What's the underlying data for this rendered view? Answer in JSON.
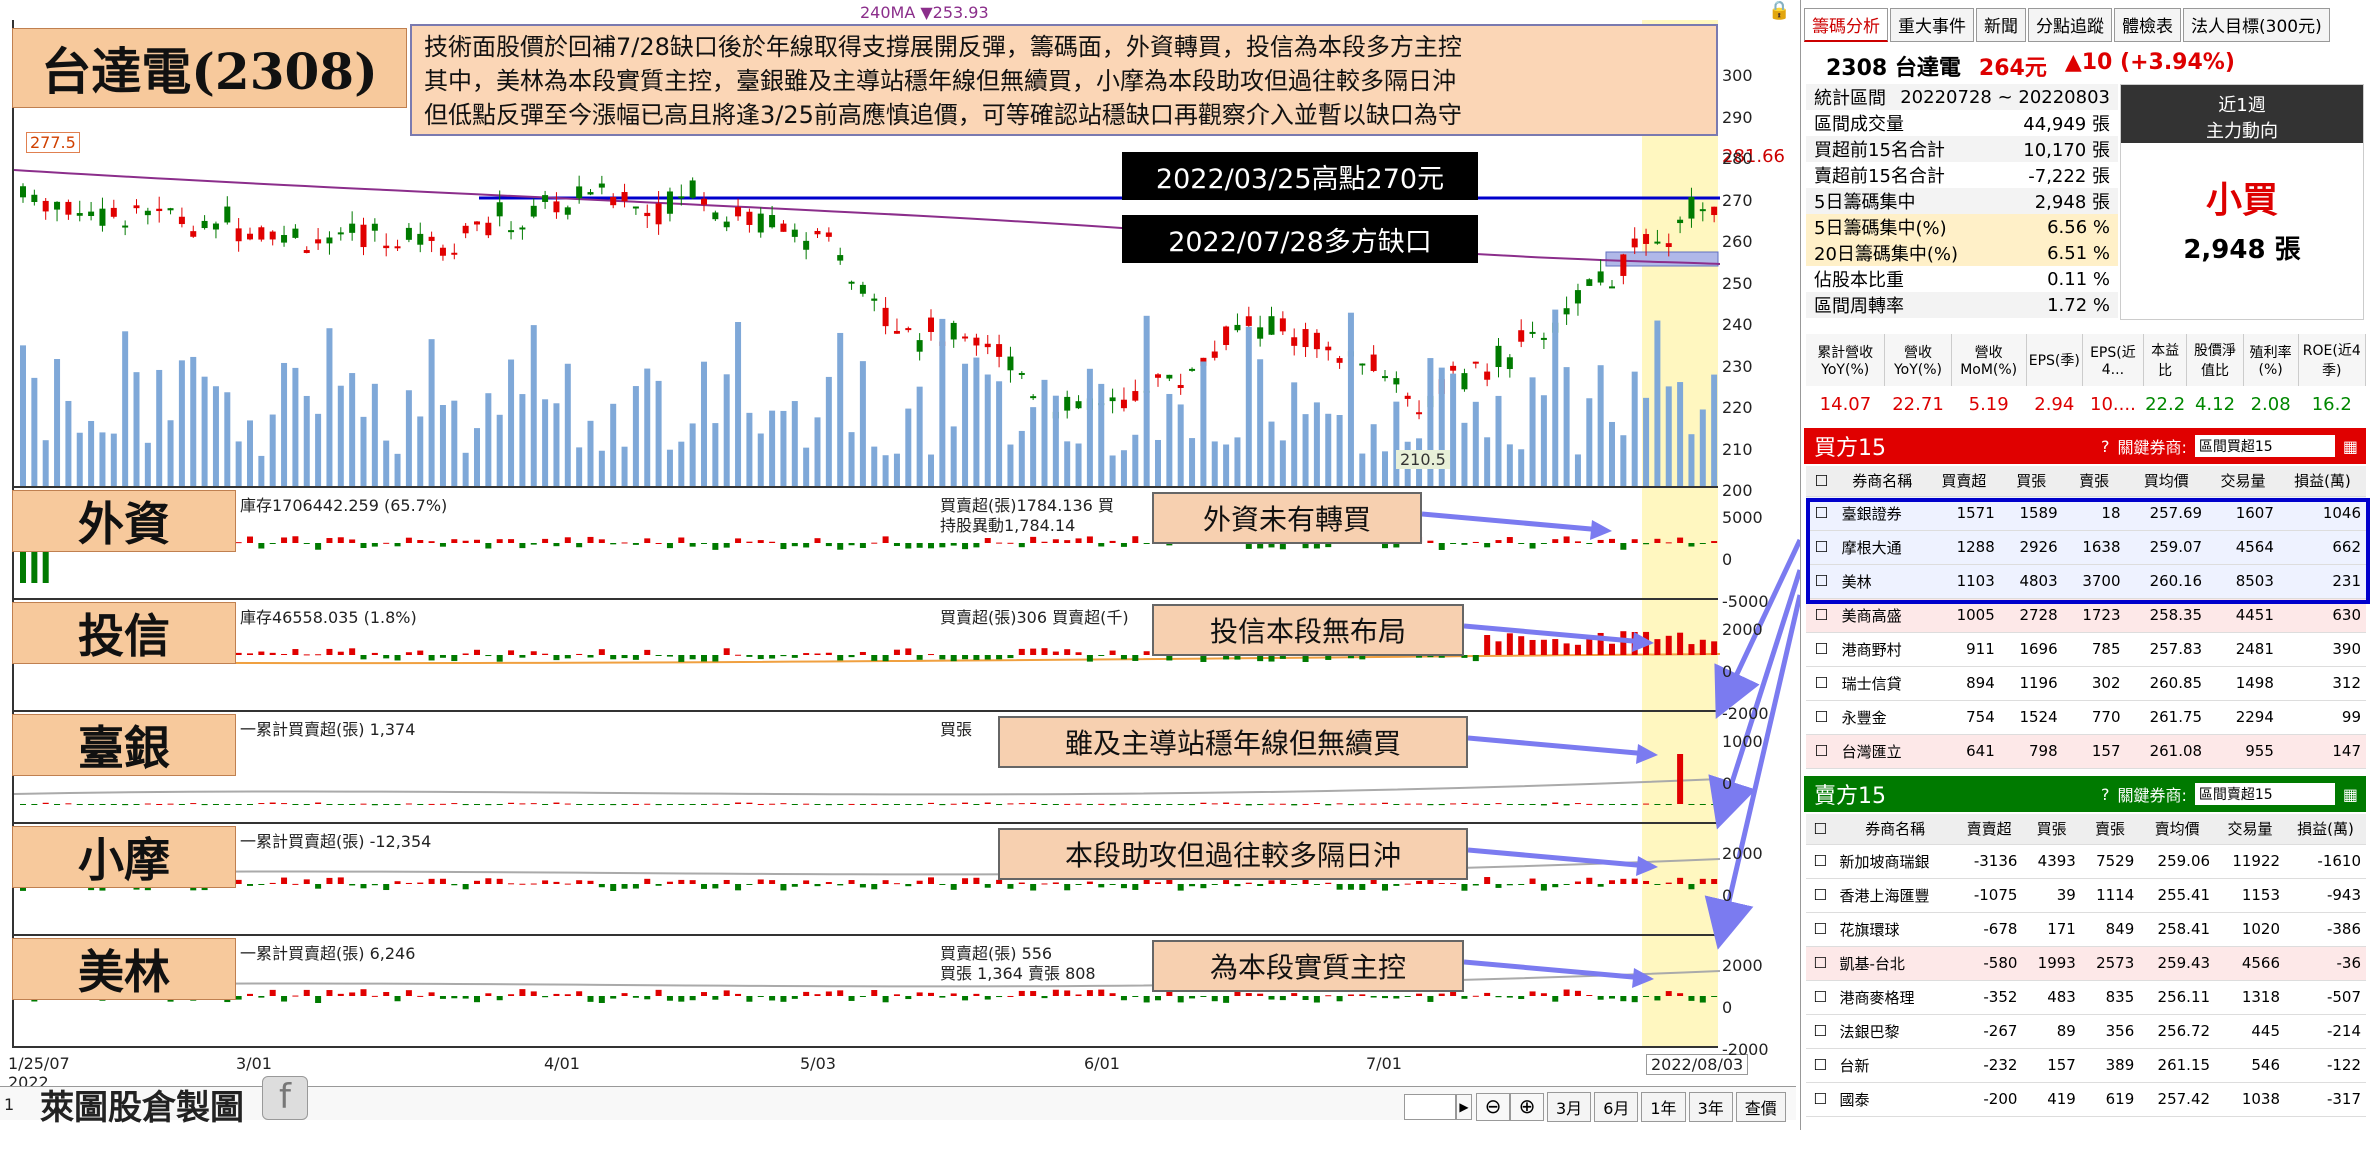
{
  "title_box": {
    "stock": "台達電(2308)"
  },
  "summary": {
    "line1": "技術面股價於回補7/28缺口後於年線取得支撐展開反彈，籌碼面，外資轉買，投信為本段多方主控",
    "line2": "其中，美林為本段實質主控，臺銀雖及主導站穩年線但無續買，小摩為本段助攻但過往較多隔日沖",
    "line3": "但低點反彈至今漲幅已高且將逢3/25前高應慎追價，可等確認站穩缺口再觀察介入並暫以缺口為守"
  },
  "ma_label": "240MA ▼253.93",
  "price_high": "277.5",
  "price_low": "210.5",
  "price_now": "281.66",
  "ref_high": "2022/03/25高點270元",
  "ref_gap": "2022/07/28多方缺口",
  "price_axis": [
    "300",
    "290",
    "280",
    "270",
    "260",
    "250",
    "240",
    "230",
    "220",
    "210",
    "200"
  ],
  "panels": {
    "foreign": {
      "label": "外資",
      "info": "庫存1706442.259 (65.7%)",
      "info2": "買賣超(張)1784.136 買",
      "info3": "持股異動1,784.14",
      "callout": "外資未有轉買",
      "axis": [
        "5000",
        "0",
        "-5000"
      ]
    },
    "trust": {
      "label": "投信",
      "info": "庫存46558.035 (1.8%)",
      "info2": "買賣超(張)306 買賣超(千)",
      "callout": "投信本段無布局",
      "axis": [
        "2000",
        "0",
        "-2000"
      ]
    },
    "taiwan_bank": {
      "label": "臺銀",
      "info": "一累計買賣超(張) 1,374",
      "info2": "買張",
      "callout": "雖及主導站穩年線但無續買",
      "axis": [
        "1000",
        "0"
      ]
    },
    "jpm": {
      "label": "小摩",
      "info": "一累計買賣超(張) -12,354",
      "info2": "",
      "callout": "本段助攻但過往較多隔日沖",
      "axis": [
        "2000",
        "0"
      ]
    },
    "merrill": {
      "label": "美林",
      "info": "一累計買賣超(張) 6,246",
      "info2": "買賣超(張) 556",
      "info3": "買張 1,364 賣張 808",
      "callout": "為本段實質主控",
      "axis": [
        "2000",
        "0",
        "-2000"
      ]
    }
  },
  "x_axis": [
    "1/25/07",
    "3/01",
    "4/01",
    "5/03",
    "6/01",
    "7/01",
    "2022/08/03"
  ],
  "x_year": "2022",
  "footer": {
    "credit": "萊圖股倉製圖",
    "fb": "f",
    "ranges": [
      "3月",
      "6月",
      "1年",
      "3年"
    ],
    "query": "查價",
    "page": "1"
  },
  "tabs": [
    "籌碼分析",
    "重大事件",
    "新聞",
    "分點追蹤",
    "體檢表",
    "法人目標(300元)"
  ],
  "stock_header": {
    "code": "2308 台達電",
    "price": "264元",
    "change": "▲10 (+3.94%)"
  },
  "stats": [
    {
      "k": "統計區間",
      "v": "20220728 ~ 20220803"
    },
    {
      "k": "區間成交量",
      "v": "44,949 張"
    },
    {
      "k": "買超前15名合計",
      "v": "10,170 張"
    },
    {
      "k": "賣超前15名合計",
      "v": "-7,222 張"
    },
    {
      "k": "5日籌碼集中",
      "v": "2,948 張"
    },
    {
      "k": "5日籌碼集中(%)",
      "v": "6.56 %"
    },
    {
      "k": "20日籌碼集中(%)",
      "v": "6.51 %"
    },
    {
      "k": "佔股本比重",
      "v": "0.11 %"
    },
    {
      "k": "區間周轉率",
      "v": "1.72 %"
    }
  ],
  "trend": {
    "period": "近1週",
    "title": "主力動向",
    "verdict": "小買",
    "amount": "2,948 張"
  },
  "fundamentals": {
    "headers": [
      "累計營收YoY(%)",
      "營收YoY(%)",
      "營收MoM(%)",
      "EPS(季)",
      "EPS(近4...",
      "本益比",
      "股價淨值比",
      "殖利率(%)",
      "ROE(近4季)"
    ],
    "values": [
      "14.07",
      "22.71",
      "5.19",
      "2.94",
      "10....",
      "22.2",
      "4.12",
      "2.08",
      "16.2"
    ]
  },
  "buy_section": {
    "title": "買方15",
    "filter_label": "關鍵券商:",
    "filter": "區間買超15",
    "cols": [
      "券商名稱",
      "買賣超",
      "買張",
      "賣張",
      "買均價",
      "交易量",
      "損益(萬)"
    ],
    "rows": [
      [
        "臺銀證券",
        "1571",
        "1589",
        "18",
        "257.69",
        "1607",
        "1046"
      ],
      [
        "摩根大通",
        "1288",
        "2926",
        "1638",
        "259.07",
        "4564",
        "662"
      ],
      [
        "美林",
        "1103",
        "4803",
        "3700",
        "260.16",
        "8503",
        "231"
      ],
      [
        "美商高盛",
        "1005",
        "2728",
        "1723",
        "258.35",
        "4451",
        "630"
      ],
      [
        "港商野村",
        "911",
        "1696",
        "785",
        "257.83",
        "2481",
        "390"
      ],
      [
        "瑞士信貸",
        "894",
        "1196",
        "302",
        "260.85",
        "1498",
        "312"
      ],
      [
        "永豐金",
        "754",
        "1524",
        "770",
        "261.75",
        "2294",
        "99"
      ],
      [
        "台灣匯立",
        "641",
        "798",
        "157",
        "261.08",
        "955",
        "147"
      ]
    ]
  },
  "sell_section": {
    "title": "賣方15",
    "filter_label": "關鍵券商:",
    "filter": "區間賣超15",
    "cols": [
      "券商名稱",
      "賣賣超",
      "買張",
      "賣張",
      "賣均價",
      "交易量",
      "損益(萬)"
    ],
    "rows": [
      [
        "新加坡商瑞銀",
        "-3136",
        "4393",
        "7529",
        "259.06",
        "11922",
        "-1610"
      ],
      [
        "香港上海匯豐",
        "-1075",
        "39",
        "1114",
        "255.41",
        "1153",
        "-943"
      ],
      [
        "花旗環球",
        "-678",
        "171",
        "849",
        "258.41",
        "1020",
        "-386"
      ],
      [
        "凱基-台北",
        "-580",
        "1993",
        "2573",
        "259.43",
        "4566",
        "-36"
      ],
      [
        "港商麥格理",
        "-352",
        "483",
        "835",
        "256.11",
        "1318",
        "-507"
      ],
      [
        "法銀巴黎",
        "-267",
        "89",
        "356",
        "256.72",
        "445",
        "-214"
      ],
      [
        "台新",
        "-232",
        "157",
        "389",
        "261.15",
        "546",
        "-122"
      ],
      [
        "國泰",
        "-200",
        "419",
        "619",
        "257.42",
        "1038",
        "-317"
      ]
    ]
  },
  "colors": {
    "up": "#e00000",
    "down": "#007a00",
    "volume": "#7fa8d8",
    "highlight": "#fff7c0",
    "callout_arrow": "#7b7bf0",
    "box_blue": "#0000cc"
  }
}
